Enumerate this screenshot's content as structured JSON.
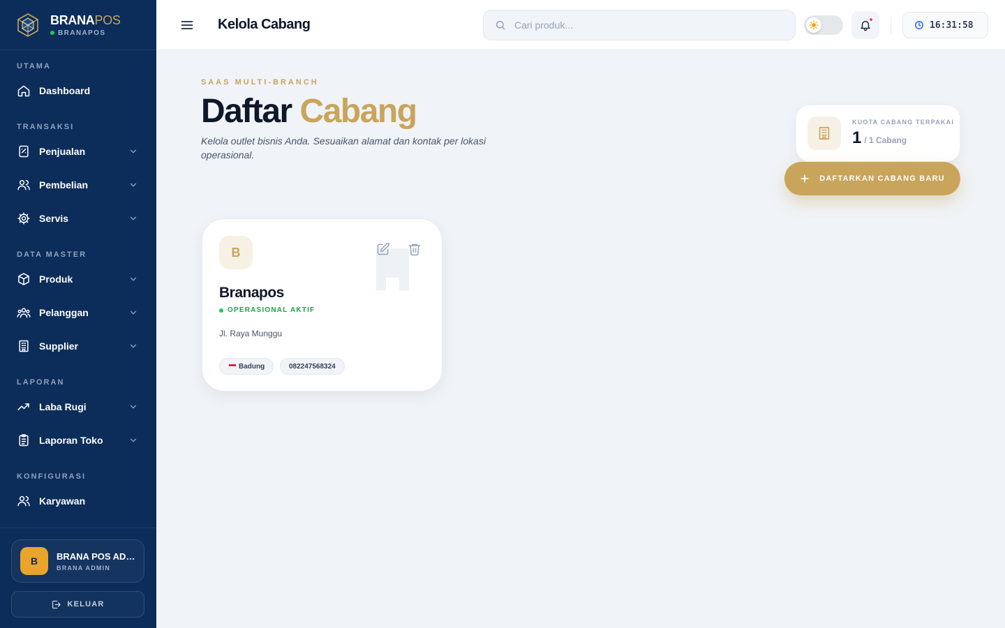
{
  "brand": {
    "name_primary": "BRANA",
    "name_accent": "POS",
    "subtitle": "BRANAPOS"
  },
  "sidebar": {
    "sections": {
      "utama": "UTAMA",
      "transaksi": "TRANSAKSI",
      "data_master": "DATA MASTER",
      "laporan": "LAPORAN",
      "konfigurasi": "KONFIGURASI"
    },
    "items": {
      "dashboard": "Dashboard",
      "penjualan": "Penjualan",
      "pembelian": "Pembelian",
      "servis": "Servis",
      "produk": "Produk",
      "pelanggan": "Pelanggan",
      "supplier": "Supplier",
      "laba_rugi": "Laba Rugi",
      "laporan_toko": "Laporan Toko",
      "karyawan": "Karyawan"
    },
    "user": {
      "initial": "B",
      "name": "BRANA POS ADMIN",
      "role": "BRANA ADMIN"
    },
    "logout_label": "KELUAR"
  },
  "header": {
    "title": "Kelola Cabang",
    "search_placeholder": "Cari produk...",
    "clock": "16:31:58"
  },
  "main": {
    "eyebrow": "SAAS MULTI-BRANCH",
    "title_primary": "Daftar",
    "title_accent": "Cabang",
    "description": "Kelola outlet bisnis Anda. Sesuaikan alamat dan kontak per lokasi operasional.",
    "quota": {
      "label": "KUOTA CABANG TERPAKAI",
      "used": "1",
      "total_text": "/ 1 Cabang"
    },
    "add_button": "DAFTARKAN CABANG BARU",
    "branches": [
      {
        "initial": "B",
        "name": "Branapos",
        "status": "OPERASIONAL AKTIF",
        "address": "Jl. Raya Munggu",
        "city": "Badung",
        "phone": "082247568324"
      }
    ]
  },
  "colors": {
    "sidebar": "#0c2d5a",
    "accent_gold": "#c9a45b",
    "status_green": "#16a34a"
  }
}
